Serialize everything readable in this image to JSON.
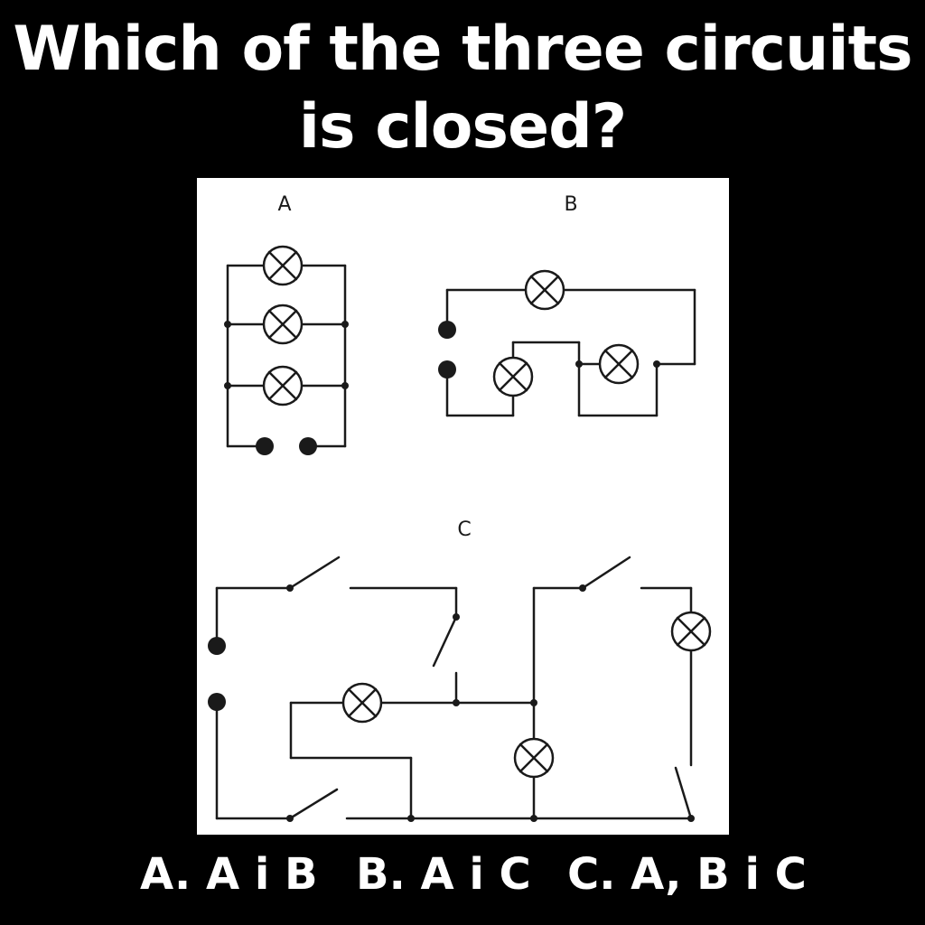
{
  "question": {
    "line1": "Which of the three circuits",
    "line2": "is closed?"
  },
  "circuits": {
    "a_label": "A",
    "b_label": "B",
    "c_label": "C"
  },
  "answers": [
    {
      "text": "A. A i B"
    },
    {
      "text": "B. A i C"
    },
    {
      "text": "C. A, B i C"
    }
  ],
  "colors": {
    "background": "#000000",
    "text": "#ffffff",
    "panel": "#ffffff",
    "ink": "#1a1a1a"
  }
}
